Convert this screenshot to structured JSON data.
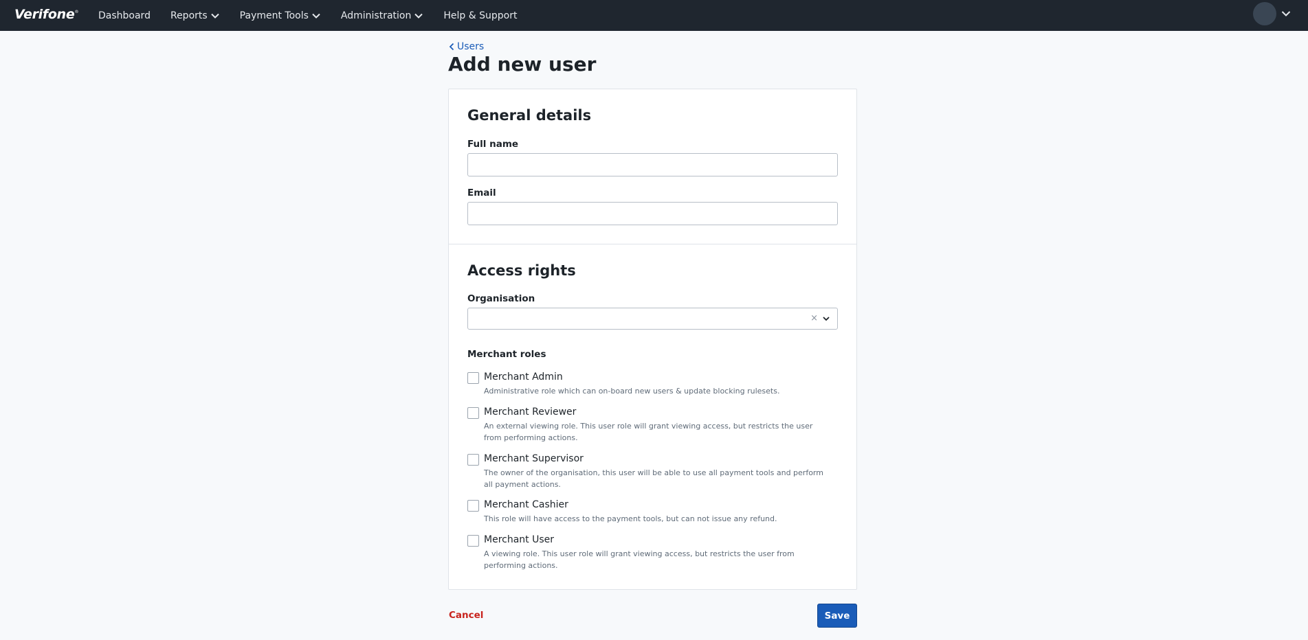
{
  "app": {
    "logo_text": "Verifone",
    "logo_mark": "®"
  },
  "nav": {
    "dashboard": "Dashboard",
    "reports": "Reports",
    "payment_tools": "Payment Tools",
    "administration": "Administration",
    "help": "Help & Support"
  },
  "breadcrumb": {
    "label": "Users"
  },
  "page": {
    "title": "Add new user"
  },
  "general": {
    "title": "General details",
    "full_name_label": "Full name",
    "full_name_value": "",
    "email_label": "Email",
    "email_value": ""
  },
  "access": {
    "title": "Access rights",
    "organisation_label": "Organisation",
    "organisation_value": "",
    "clear_symbol": "×",
    "merchant_roles_label": "Merchant roles",
    "roles": [
      {
        "name": "Merchant Admin",
        "description": "Administrative role which can on-board new users & update blocking rulesets.",
        "checked": false
      },
      {
        "name": "Merchant Reviewer",
        "description": "An external viewing role. This user role will grant viewing access, but restricts the user from performing actions.",
        "checked": false
      },
      {
        "name": "Merchant Supervisor",
        "description": "The owner of the organisation, this user will be able to use all payment tools and perform all payment actions.",
        "checked": false
      },
      {
        "name": "Merchant Cashier",
        "description": "This role will have access to the payment tools, but can not issue any refund.",
        "checked": false
      },
      {
        "name": "Merchant User",
        "description": "A viewing role. This user role will grant viewing access, but restricts the user from performing actions.",
        "checked": false
      }
    ]
  },
  "actions": {
    "cancel_label": "Cancel",
    "save_label": "Save"
  },
  "colors": {
    "topbar": "#1f262f",
    "primary": "#1a5cb8",
    "danger": "#c8231d",
    "background": "#f7f9fb"
  }
}
